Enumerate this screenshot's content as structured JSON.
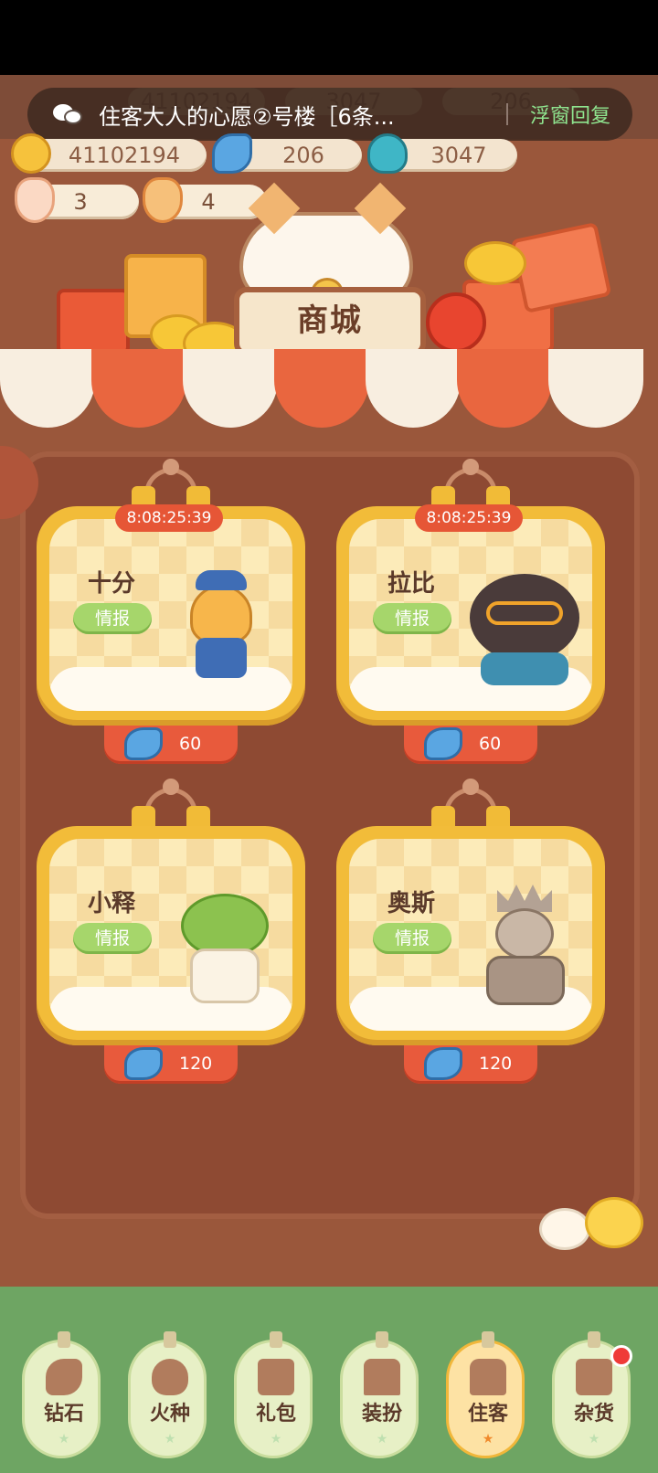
{
  "notification": {
    "title": "住客大人的心愿②号楼［6条...",
    "reply": "浮窗回复"
  },
  "faded_header": {
    "values": [
      "41102194",
      "3047",
      "206"
    ]
  },
  "currencies": [
    {
      "icon": "gold-ingot-icon",
      "value": "41102194"
    },
    {
      "icon": "blue-bean-icon",
      "value": "206"
    },
    {
      "icon": "flame-seed-icon",
      "value": "3047"
    }
  ],
  "tickets": [
    {
      "icon": "paw-ticket-pink-icon",
      "value": "3"
    },
    {
      "icon": "paw-ticket-orange-icon",
      "value": "4"
    }
  ],
  "shop": {
    "title": "商城"
  },
  "characters": [
    {
      "name": "十分",
      "timer": "8:08:25:39",
      "intel": "情报",
      "price": "60",
      "icon": "lightbulb-conductor-icon"
    },
    {
      "name": "拉比",
      "timer": "8:08:25:39",
      "intel": "情报",
      "price": "60",
      "icon": "bear-glasses-icon"
    },
    {
      "name": "小释",
      "timer": "",
      "intel": "情报",
      "price": "120",
      "icon": "broccoli-scarf-icon"
    },
    {
      "name": "奥斯",
      "timer": "",
      "intel": "情报",
      "price": "120",
      "icon": "stone-king-statue-icon"
    }
  ],
  "nav": {
    "tabs": [
      {
        "label": "钻石",
        "icon": "bean-icon",
        "active": false
      },
      {
        "label": "火种",
        "icon": "flame-icon",
        "active": false
      },
      {
        "label": "礼包",
        "icon": "gift-icon",
        "active": false
      },
      {
        "label": "装扮",
        "icon": "brush-icon",
        "active": false
      },
      {
        "label": "住客",
        "icon": "resident-shirt-icon",
        "active": true
      },
      {
        "label": "杂货",
        "icon": "goods-icon",
        "active": false
      }
    ]
  },
  "colors": {
    "timer": "#e65636",
    "intel_button": "#a6d66b",
    "card_frame": "#f2bc39",
    "price_tag": "#e85a3c",
    "panel": "#8e4a33",
    "nav_active": "#fde2a4"
  }
}
